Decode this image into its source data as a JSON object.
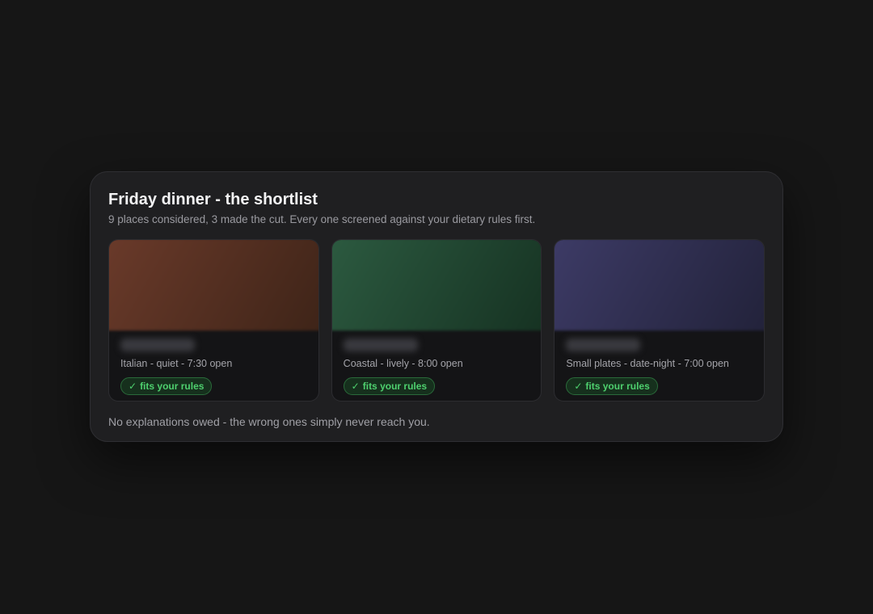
{
  "panel": {
    "title": "Friday dinner - the shortlist",
    "subtitle": "9 places considered, 3 made the cut. Every one screened against your dietary rules first.",
    "footnote": "No explanations owed - the wrong ones simply never reach you."
  },
  "cards": [
    {
      "name": "",
      "meta": "Italian - quiet - 7:30 open",
      "badge": "fits your rules",
      "badge_icon": "check-icon",
      "image_colors": [
        "#6a3a2a",
        "#3e2418"
      ]
    },
    {
      "name": "",
      "meta": "Coastal - lively - 8:00 open",
      "badge": "fits your rules",
      "badge_icon": "check-icon",
      "image_colors": [
        "#2c5a40",
        "#163222"
      ]
    },
    {
      "name": "",
      "meta": "Small plates - date-night - 7:00 open",
      "badge": "fits your rules",
      "badge_icon": "check-icon",
      "image_colors": [
        "#3d3b66",
        "#22223a"
      ]
    }
  ],
  "colors": {
    "background": "#161616",
    "panel": "#1f1f21",
    "badge_text": "#4ed06e",
    "badge_fill": "#16301d"
  }
}
